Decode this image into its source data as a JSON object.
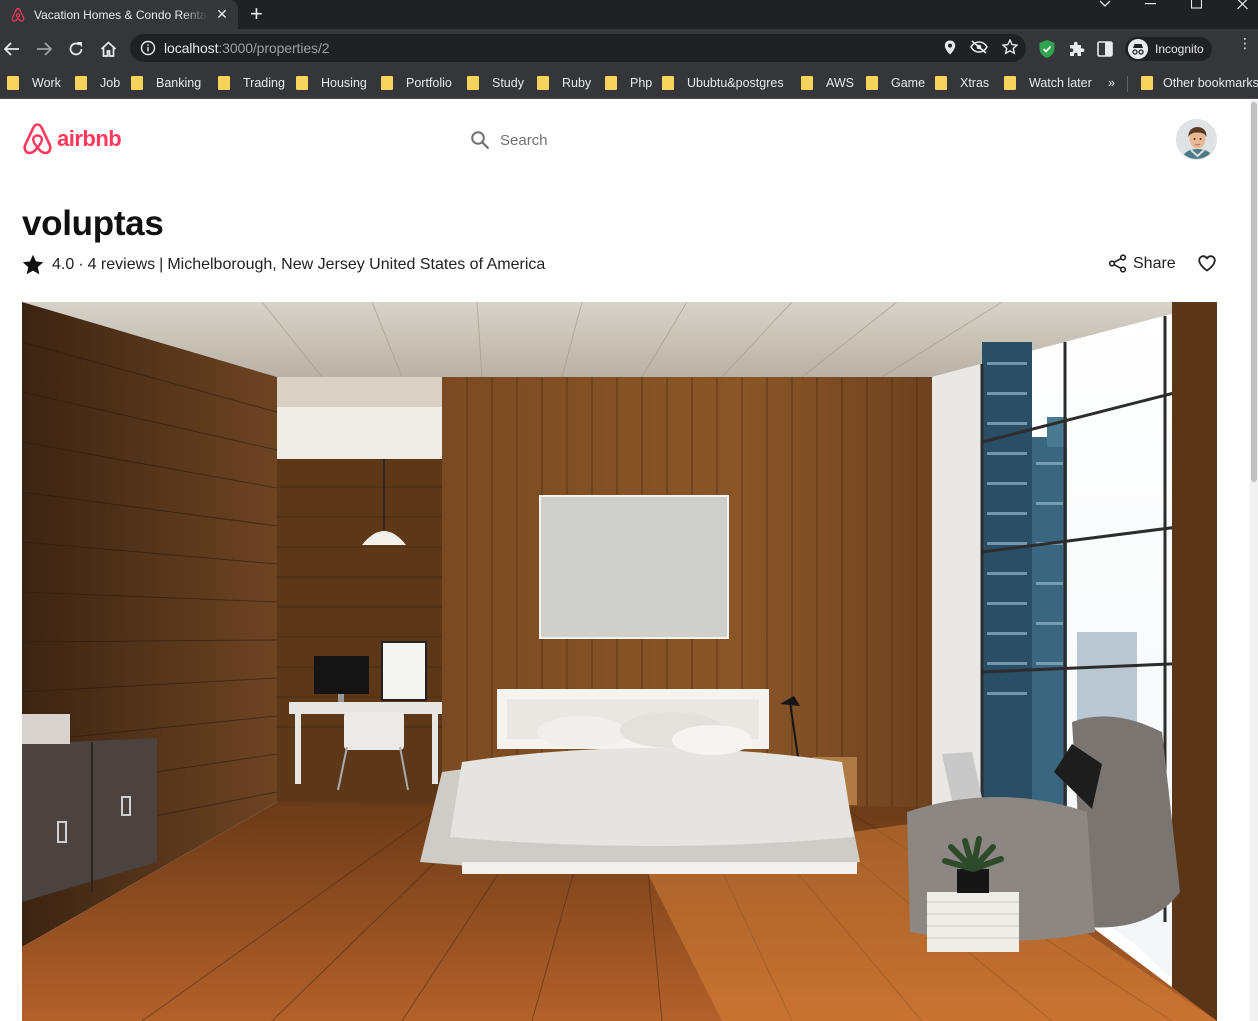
{
  "browser": {
    "tab_title": "Vacation Homes & Condo Rentals - Airbnb",
    "url_host": "localhost",
    "url_path": ":3000/properties/2",
    "profile_label": "Incognito",
    "bookmarks": [
      "Work",
      "Job",
      "Banking",
      "Trading",
      "Housing",
      "Portfolio",
      "Study",
      "Ruby",
      "Php",
      "Ububtu&postgres",
      "AWS",
      "Game",
      "Xtras",
      "Watch later"
    ],
    "overflow": "»",
    "other_bookmarks": "Other bookmarks"
  },
  "header": {
    "logo_text": "airbnb",
    "search_placeholder": "Search",
    "brand_color": "#ff385c"
  },
  "listing": {
    "title": "voluptas",
    "rating": "4.0",
    "dot": "·",
    "reviews": "4 reviews",
    "divider": "|",
    "location": "Michelborough, New Jersey United States of America",
    "share_label": "Share"
  },
  "photo": {
    "subject": "bedroom with wood-paneled walls, bed, desk and city-view window"
  }
}
